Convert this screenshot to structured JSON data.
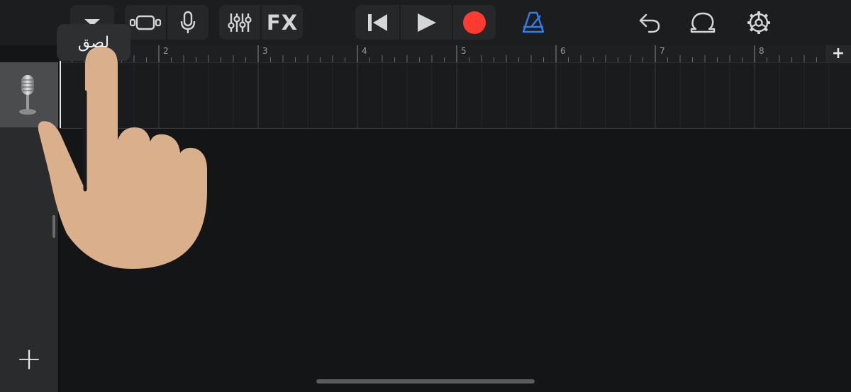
{
  "toolbar": {
    "fx_label": "FX",
    "icons": [
      "tracks-dropdown-icon",
      "browser-icon",
      "microphone-icon",
      "mixer-icon",
      "rewind-icon",
      "play-icon",
      "record-icon",
      "metronome-icon",
      "undo-icon",
      "loop-icon",
      "settings-icon"
    ],
    "record_color": "#ff3b30",
    "metronome_color": "#2f80ed"
  },
  "ruler": {
    "bars": [
      "2",
      "3",
      "4",
      "5",
      "6",
      "7",
      "8"
    ],
    "add_label": "+"
  },
  "tracks": [
    {
      "instrument": "microphone-icon"
    }
  ],
  "sidebar": {
    "add_track_label": "+"
  },
  "tooltip": {
    "text": "لصق"
  }
}
